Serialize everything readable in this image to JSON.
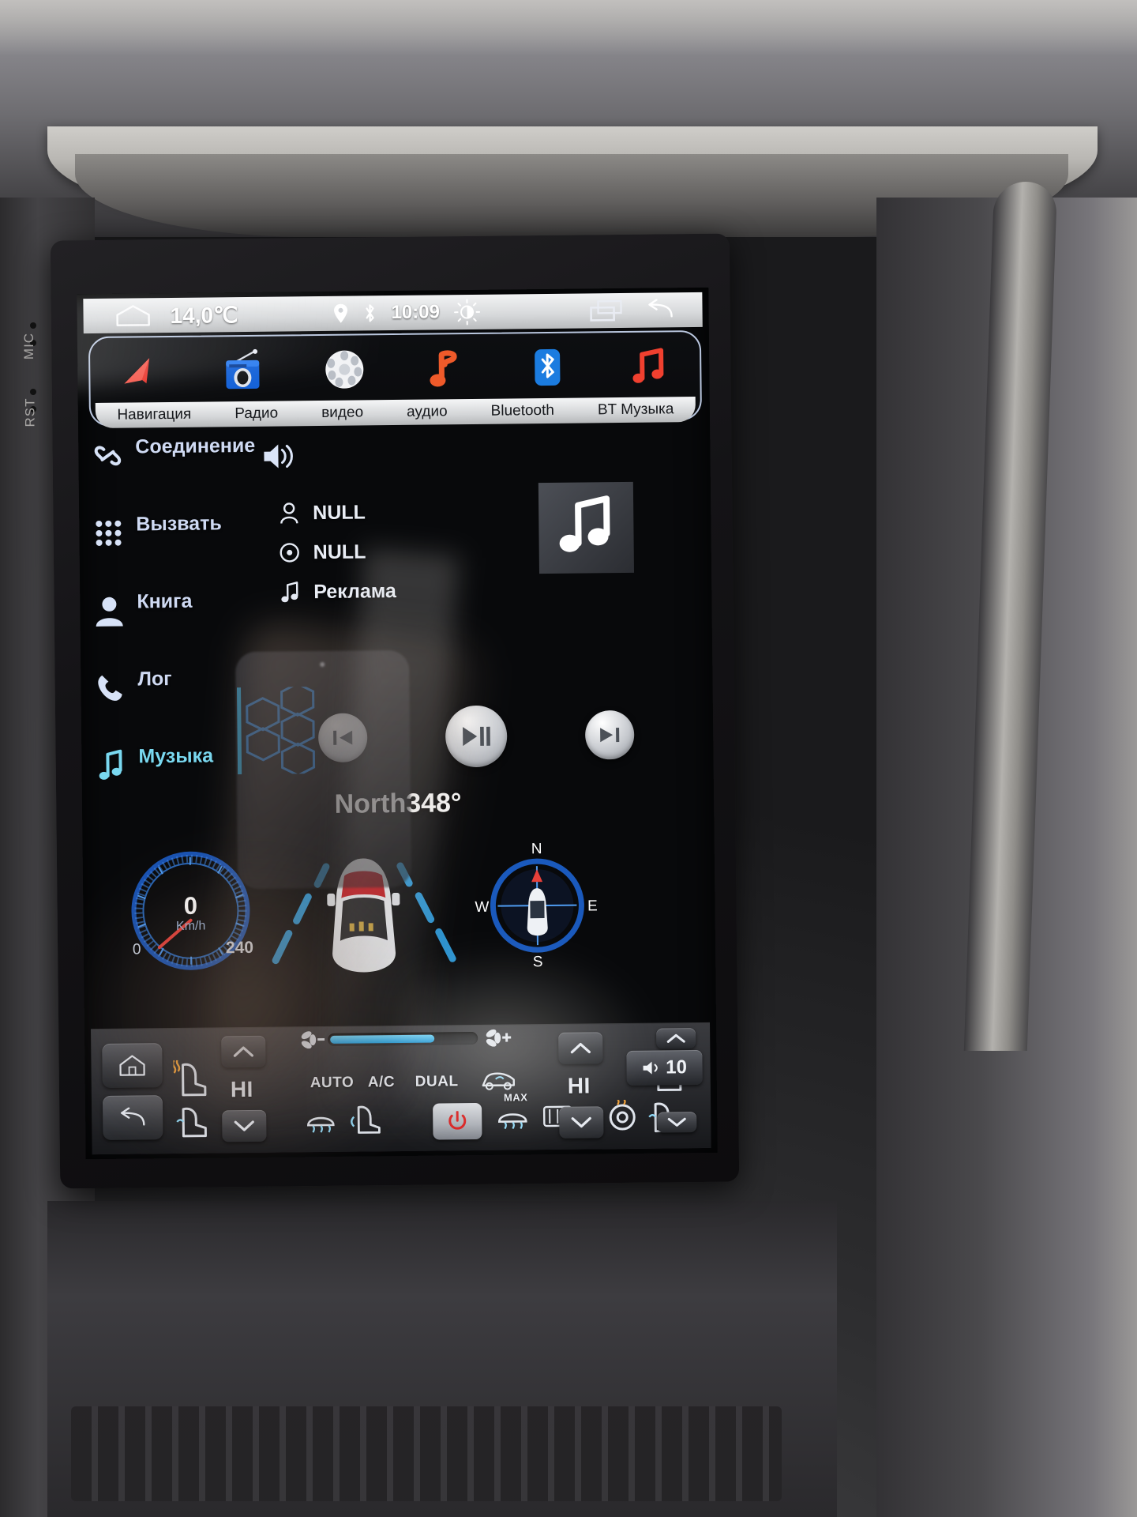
{
  "status_bar": {
    "home_icon": "home-icon",
    "temperature": "14,0℃",
    "location_icon": "location-pin-icon",
    "bluetooth_icon": "bluetooth-icon",
    "time": "10:09",
    "brightness_icon": "brightness-icon",
    "recents_icon": "recent-apps-icon",
    "back_icon": "back-arrow-icon"
  },
  "dock": {
    "items": [
      {
        "label": "Навигация",
        "icon": "navigation-arrow-icon"
      },
      {
        "label": "Радио",
        "icon": "radio-icon"
      },
      {
        "label": "видео",
        "icon": "film-reel-icon"
      },
      {
        "label": "аудио",
        "icon": "music-note-icon"
      },
      {
        "label": "Bluetooth",
        "icon": "bluetooth-icon"
      },
      {
        "label": "BT Музыка",
        "icon": "bt-music-icon"
      }
    ]
  },
  "sidebar": {
    "items": [
      {
        "label": "Соединение",
        "icon": "link-icon",
        "active": false
      },
      {
        "label": "Вызвать",
        "icon": "dialpad-icon",
        "active": false
      },
      {
        "label": "Книга",
        "icon": "contact-person-icon",
        "active": false
      },
      {
        "label": "Лог",
        "icon": "phone-handset-icon",
        "active": false
      },
      {
        "label": "Музыка",
        "icon": "music-note-icon",
        "active": true
      }
    ],
    "speaker_icon": "speaker-on-icon"
  },
  "track_info": {
    "rows": [
      {
        "icon": "artist-icon",
        "text": "NULL"
      },
      {
        "icon": "album-icon",
        "text": "NULL"
      },
      {
        "icon": "track-note-icon",
        "text": "Реклама"
      }
    ],
    "album_art_icon": "music-note-icon"
  },
  "player": {
    "prev_icon": "skip-previous-icon",
    "play_pause_icon": "play-pause-icon",
    "next_icon": "skip-next-icon",
    "equalizer_icon": "equalizer-visualizer-icon"
  },
  "nav_widget": {
    "heading": "North348°",
    "speed_value": "0",
    "speed_unit": "Km/h",
    "speed_min": "0",
    "speed_max": "240",
    "car_icon": "car-top-view-icon",
    "compass": {
      "north": "N",
      "east": "E",
      "south": "S",
      "west": "W",
      "needle_icon": "compass-needle-icon"
    }
  },
  "climate_bar": {
    "home_button": "home-icon",
    "back_button": "back-arrow-icon",
    "left_seat_heat_icon": "seat-heat-icon",
    "left_temp": "HI",
    "left_up_icon": "chevron-up-icon",
    "left_down_icon": "chevron-down-icon",
    "fan_down_icon": "fan-minus-icon",
    "fan_up_icon": "fan-plus-icon",
    "auto_label": "AUTO",
    "ac_label": "A/C",
    "dual_label": "DUAL",
    "rear_defrost_icon": "rear-defrost-icon",
    "front_defrost_icon": "front-defrost-icon",
    "recirculate_icon": "air-recirculate-icon",
    "max_label": "MAX",
    "max_defrost_icon": "max-defrost-icon",
    "heated_steering_icon": "heated-steering-wheel-icon",
    "power_icon": "power-icon",
    "right_temp": "HI",
    "right_up_icon": "chevron-up-icon",
    "right_down_icon": "chevron-down-icon",
    "right_seat_heat_icon": "seat-heat-icon",
    "volume_icon": "volume-icon",
    "volume_value": "10",
    "vol_up_icon": "chevron-up-icon",
    "vol_down_icon": "chevron-down-icon"
  },
  "hardware": {
    "mic_label": "MIC",
    "rst_label": "RST"
  },
  "colors": {
    "accent_blue": "#2f9fe0",
    "active_cyan": "#79d8f0",
    "status_bg": "#e6e8ea",
    "screen_bg": "#08090b"
  }
}
